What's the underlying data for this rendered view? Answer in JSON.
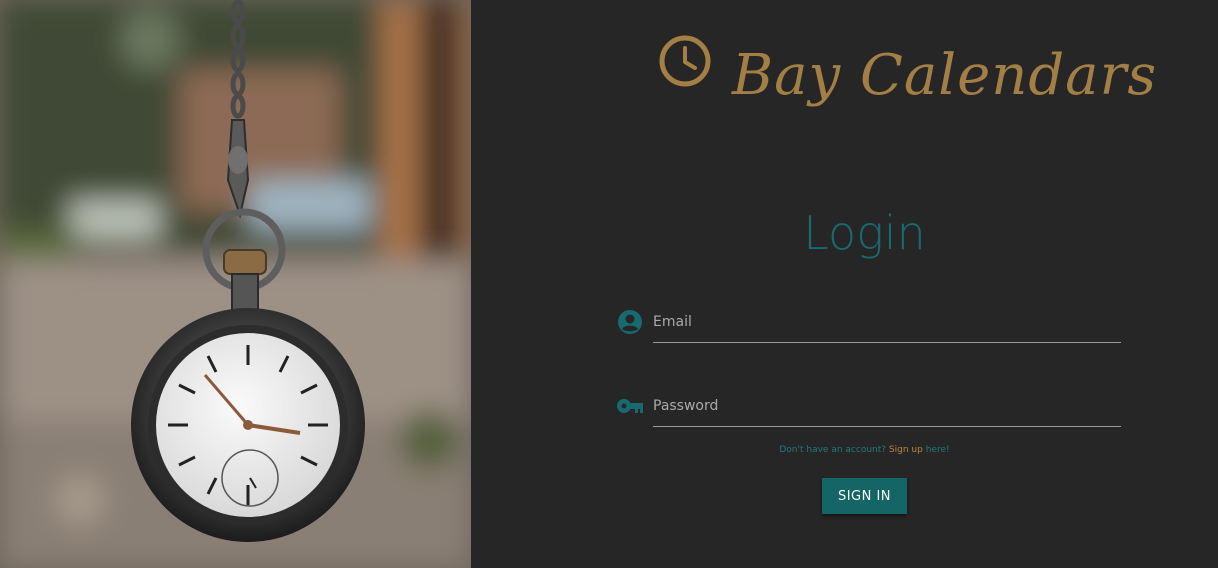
{
  "brand": {
    "name": "Bay Calendars",
    "icon": "clock-icon"
  },
  "photo": {
    "description_icon": "pocket-watch-image"
  },
  "login": {
    "title": "Login",
    "email_placeholder": "Email",
    "email_value": "",
    "password_placeholder": "Password",
    "password_value": "",
    "signup_prefix": "Don't have an account?",
    "signup_link": "Sign up",
    "signup_suffix": "here!",
    "submit_label": "SIGN IN"
  },
  "colors": {
    "background": "#262626",
    "accent_gold": "#a37e45",
    "accent_teal": "#176b70",
    "button": "#136566"
  }
}
